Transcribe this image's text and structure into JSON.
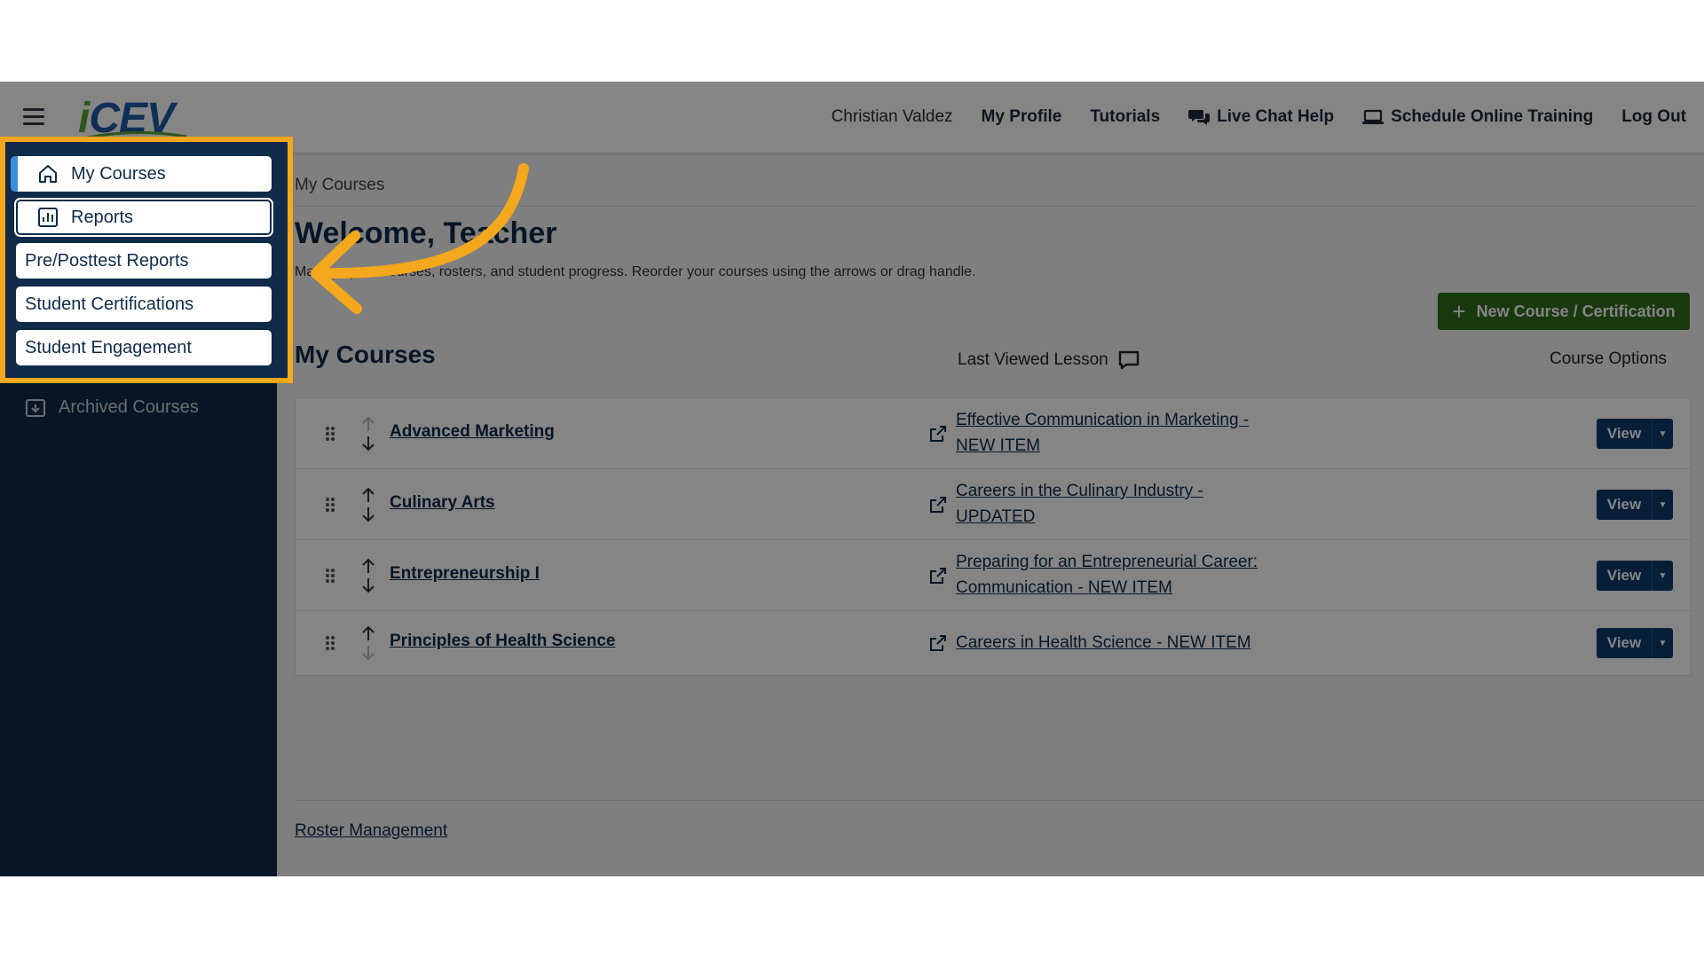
{
  "brand": {
    "logo_i": "i",
    "logo_rest": "CEV"
  },
  "topnav": {
    "user": "Christian Valdez",
    "my_profile": "My Profile",
    "tutorials": "Tutorials",
    "live_chat": "Live Chat Help",
    "schedule": "Schedule Online Training",
    "logout": "Log Out"
  },
  "sidebar": {
    "my_courses": "My Courses",
    "reports": "Reports",
    "pre_post": "Pre/Posttest Reports",
    "certs": "Student Certifications",
    "engagement": "Student Engagement",
    "archived": "Archived Courses"
  },
  "main": {
    "breadcrumb": "My Courses",
    "welcome": "Welcome, Teacher",
    "subtitle": "Manage your courses, rosters, and student progress. Reorder your courses using the arrows or drag handle.",
    "new_button": "New Course / Certification",
    "section_title": "My Courses",
    "col_last_viewed": "Last Viewed Lesson",
    "col_options": "Course Options",
    "view_label": "View",
    "roster_link": "Roster Management"
  },
  "courses": [
    {
      "name": "Advanced Marketing",
      "lesson_line1": "Effective Communication in Marketing -",
      "lesson_line2": "NEW ITEM"
    },
    {
      "name": "Culinary Arts",
      "lesson_line1": "Careers in the Culinary Industry -",
      "lesson_line2": "UPDATED"
    },
    {
      "name": "Entrepreneurship I",
      "lesson_line1": "Preparing for an Entrepreneurial Career:",
      "lesson_line2": "Communication - NEW ITEM"
    },
    {
      "name": "Principles of Health Science",
      "lesson_line1": "Careers in Health Science - NEW ITEM",
      "lesson_line2": ""
    }
  ],
  "colors": {
    "navy": "#0f2b49",
    "highlight": "#f4a81d",
    "green": "#2f6d1b",
    "view_button": "#0f3a6e"
  },
  "icons": [
    "menu-icon",
    "home-icon",
    "reports-icon",
    "archive-icon",
    "chat-icon",
    "laptop-icon",
    "comment-icon",
    "drag-handle-icon",
    "reorder-arrows-icon",
    "external-link-icon",
    "plus-icon",
    "caret-down-icon",
    "pointer-arrow"
  ]
}
